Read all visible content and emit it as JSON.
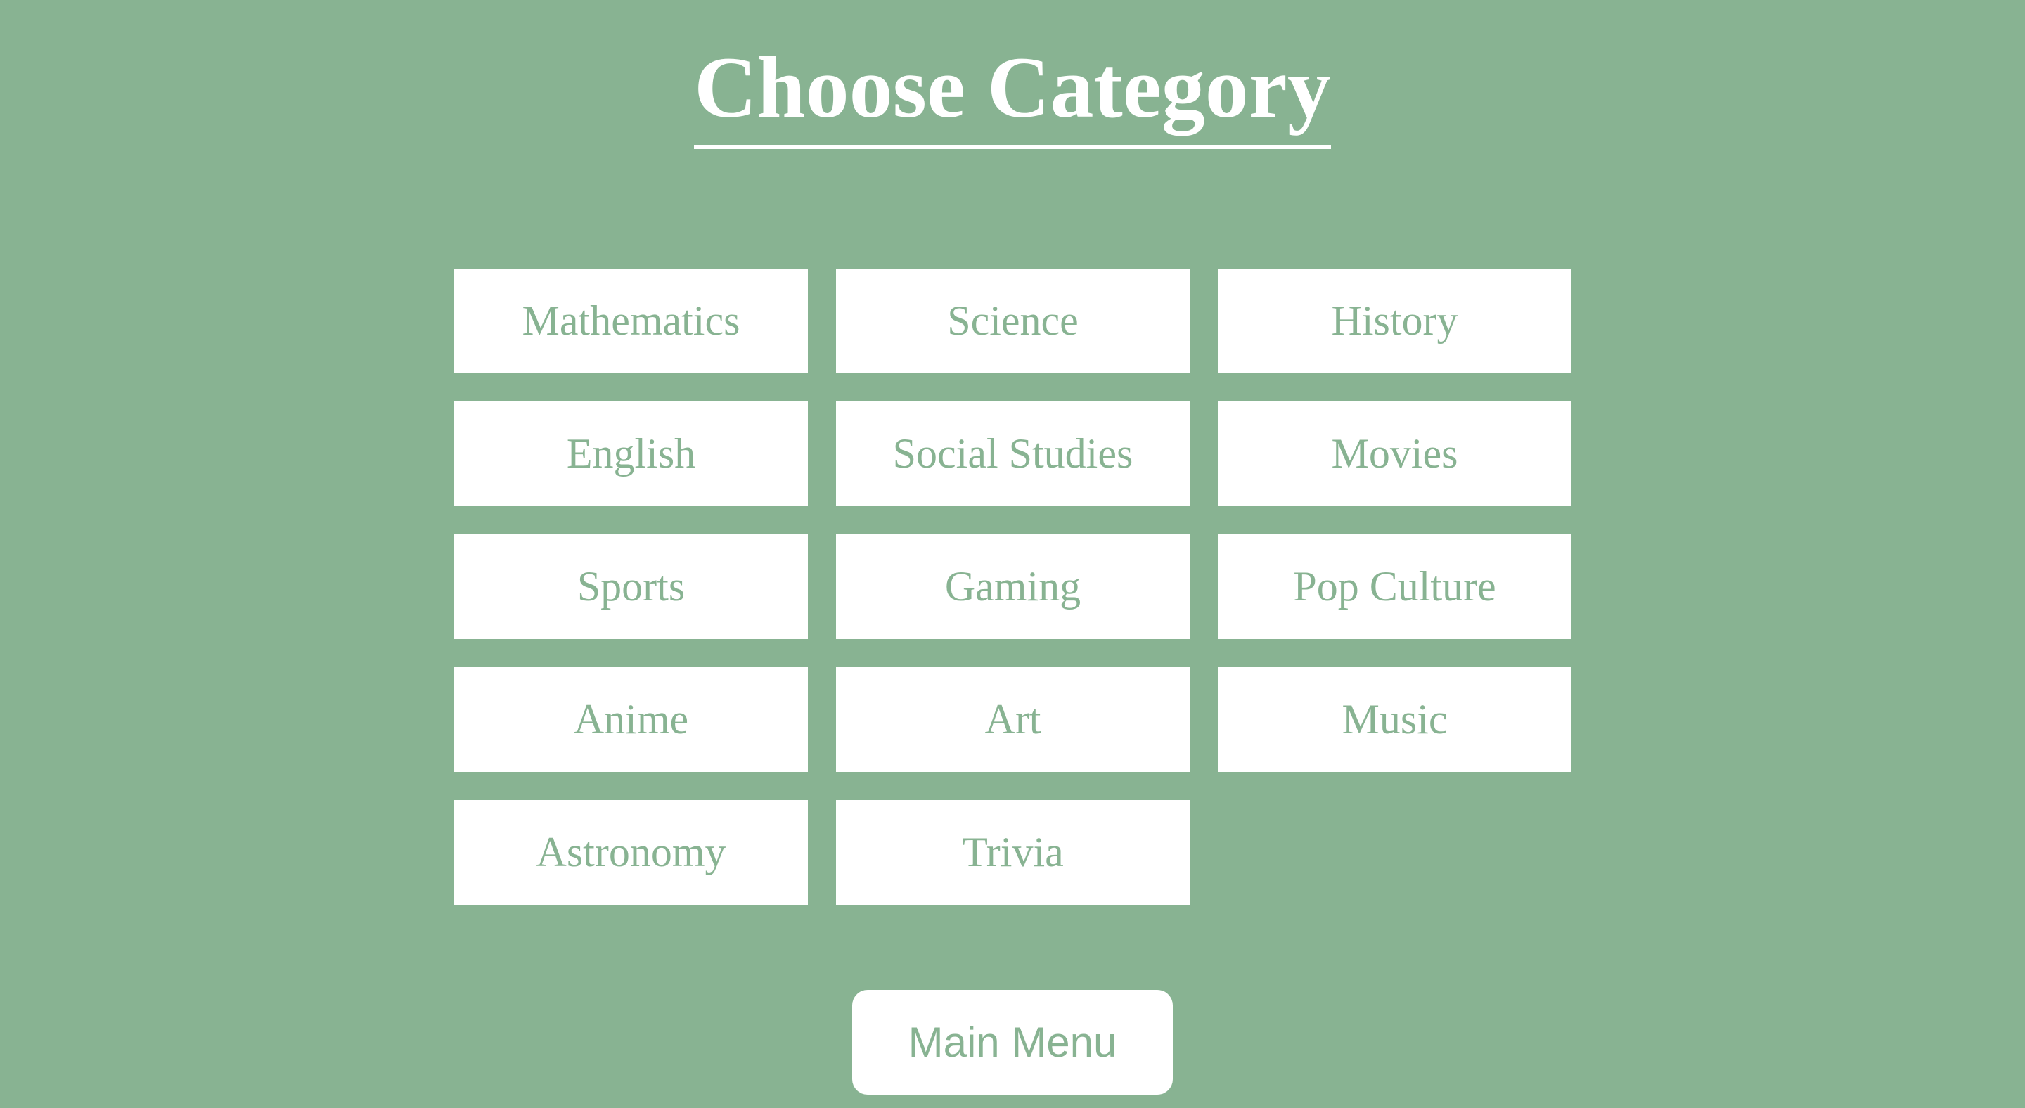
{
  "header": {
    "title": "Choose Category"
  },
  "categories": [
    {
      "label": "Mathematics"
    },
    {
      "label": "Science"
    },
    {
      "label": "History"
    },
    {
      "label": "English"
    },
    {
      "label": "Social Studies"
    },
    {
      "label": "Movies"
    },
    {
      "label": "Sports"
    },
    {
      "label": "Gaming"
    },
    {
      "label": "Pop Culture"
    },
    {
      "label": "Anime"
    },
    {
      "label": "Art"
    },
    {
      "label": "Music"
    },
    {
      "label": "Astronomy"
    },
    {
      "label": "Trivia"
    }
  ],
  "footer": {
    "main_menu_label": "Main Menu"
  },
  "colors": {
    "background": "#88b392",
    "button_background": "#ffffff",
    "button_text": "#88b392",
    "title_text": "#ffffff"
  }
}
